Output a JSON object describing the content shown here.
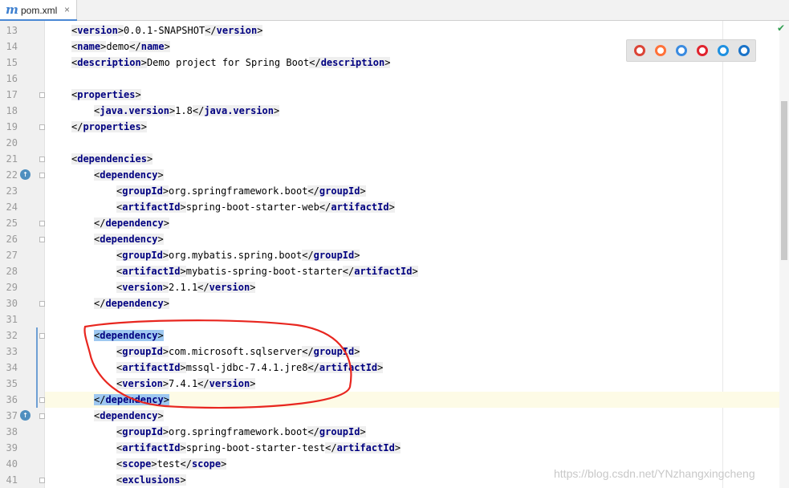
{
  "tab": {
    "icon_glyph": "m",
    "filename": "pom.xml",
    "close_glyph": "×"
  },
  "status": {
    "check_glyph": "✔",
    "check_color": "#2e9e4f"
  },
  "browsers": [
    {
      "name": "chrome-icon",
      "color": "#db4437"
    },
    {
      "name": "firefox-icon",
      "color": "#ff7139"
    },
    {
      "name": "safari-icon",
      "color": "#3a8be0"
    },
    {
      "name": "opera-icon",
      "color": "#e0242e"
    },
    {
      "name": "ie-icon",
      "color": "#1e90e0"
    },
    {
      "name": "edge-icon",
      "color": "#1a73c8"
    }
  ],
  "lines": [
    {
      "n": "13",
      "indent": 0,
      "parts": [
        [
          "o",
          "version"
        ],
        [
          "t",
          "0.0.1-SNAPSHOT"
        ],
        [
          "c",
          "version"
        ]
      ]
    },
    {
      "n": "14",
      "indent": 0,
      "parts": [
        [
          "o",
          "name"
        ],
        [
          "t",
          "demo"
        ],
        [
          "c",
          "name"
        ]
      ]
    },
    {
      "n": "15",
      "indent": 0,
      "parts": [
        [
          "o",
          "description"
        ],
        [
          "t",
          "Demo project for Spring Boot"
        ],
        [
          "c",
          "description"
        ]
      ]
    },
    {
      "n": "16",
      "indent": 0,
      "parts": []
    },
    {
      "n": "17",
      "indent": 0,
      "parts": [
        [
          "o",
          "properties"
        ]
      ],
      "fold": true
    },
    {
      "n": "18",
      "indent": 1,
      "parts": [
        [
          "o",
          "java.version"
        ],
        [
          "t",
          "1.8"
        ],
        [
          "c",
          "java.version"
        ]
      ]
    },
    {
      "n": "19",
      "indent": 0,
      "parts": [
        [
          "c",
          "properties"
        ]
      ],
      "fold": true
    },
    {
      "n": "20",
      "indent": 0,
      "parts": []
    },
    {
      "n": "21",
      "indent": 0,
      "parts": [
        [
          "o",
          "dependencies"
        ]
      ],
      "fold": true
    },
    {
      "n": "22",
      "indent": 1,
      "parts": [
        [
          "o",
          "dependency"
        ]
      ],
      "fold": true,
      "run": true
    },
    {
      "n": "23",
      "indent": 2,
      "parts": [
        [
          "o",
          "groupId"
        ],
        [
          "t",
          "org.springframework.boot"
        ],
        [
          "c",
          "groupId"
        ]
      ]
    },
    {
      "n": "24",
      "indent": 2,
      "parts": [
        [
          "o",
          "artifactId"
        ],
        [
          "t",
          "spring-boot-starter-web"
        ],
        [
          "c",
          "artifactId"
        ]
      ]
    },
    {
      "n": "25",
      "indent": 1,
      "parts": [
        [
          "c",
          "dependency"
        ]
      ],
      "fold": true
    },
    {
      "n": "26",
      "indent": 1,
      "parts": [
        [
          "o",
          "dependency"
        ]
      ],
      "fold": true
    },
    {
      "n": "27",
      "indent": 2,
      "parts": [
        [
          "o",
          "groupId"
        ],
        [
          "t",
          "org.mybatis.spring.boot"
        ],
        [
          "c",
          "groupId"
        ]
      ]
    },
    {
      "n": "28",
      "indent": 2,
      "parts": [
        [
          "o",
          "artifactId"
        ],
        [
          "t",
          "mybatis-spring-boot-starter"
        ],
        [
          "c",
          "artifactId"
        ]
      ]
    },
    {
      "n": "29",
      "indent": 2,
      "parts": [
        [
          "o",
          "version"
        ],
        [
          "t",
          "2.1.1"
        ],
        [
          "c",
          "version"
        ]
      ]
    },
    {
      "n": "30",
      "indent": 1,
      "parts": [
        [
          "c",
          "dependency"
        ]
      ],
      "fold": true
    },
    {
      "n": "31",
      "indent": 0,
      "parts": []
    },
    {
      "n": "32",
      "indent": 1,
      "parts": [
        [
          "o",
          "dependency"
        ]
      ],
      "fold": true,
      "hl": true,
      "vbar": true
    },
    {
      "n": "33",
      "indent": 2,
      "parts": [
        [
          "o",
          "groupId"
        ],
        [
          "t",
          "com.microsoft.sqlserver"
        ],
        [
          "c",
          "groupId"
        ]
      ],
      "vbar": true
    },
    {
      "n": "34",
      "indent": 2,
      "parts": [
        [
          "o",
          "artifactId"
        ],
        [
          "t",
          "mssql-jdbc-7.4.1.jre8"
        ],
        [
          "c",
          "artifactId"
        ]
      ],
      "vbar": true
    },
    {
      "n": "35",
      "indent": 2,
      "parts": [
        [
          "o",
          "version"
        ],
        [
          "t",
          "7.4.1"
        ],
        [
          "c",
          "version"
        ]
      ],
      "vbar": true
    },
    {
      "n": "36",
      "indent": 1,
      "parts": [
        [
          "c",
          "dependency"
        ]
      ],
      "fold": true,
      "hl": true,
      "current": true,
      "vbar": true
    },
    {
      "n": "37",
      "indent": 1,
      "parts": [
        [
          "o",
          "dependency"
        ]
      ],
      "fold": true,
      "run": true
    },
    {
      "n": "38",
      "indent": 2,
      "parts": [
        [
          "o",
          "groupId"
        ],
        [
          "t",
          "org.springframework.boot"
        ],
        [
          "c",
          "groupId"
        ]
      ]
    },
    {
      "n": "39",
      "indent": 2,
      "parts": [
        [
          "o",
          "artifactId"
        ],
        [
          "t",
          "spring-boot-starter-test"
        ],
        [
          "c",
          "artifactId"
        ]
      ]
    },
    {
      "n": "40",
      "indent": 2,
      "parts": [
        [
          "o",
          "scope"
        ],
        [
          "t",
          "test"
        ],
        [
          "c",
          "scope"
        ]
      ]
    },
    {
      "n": "41",
      "indent": 2,
      "parts": [
        [
          "o",
          "exclusions"
        ]
      ],
      "fold": true
    }
  ],
  "watermark": "https://blog.csdn.net/YNzhangxingcheng",
  "annotation_color": "#e8261f"
}
